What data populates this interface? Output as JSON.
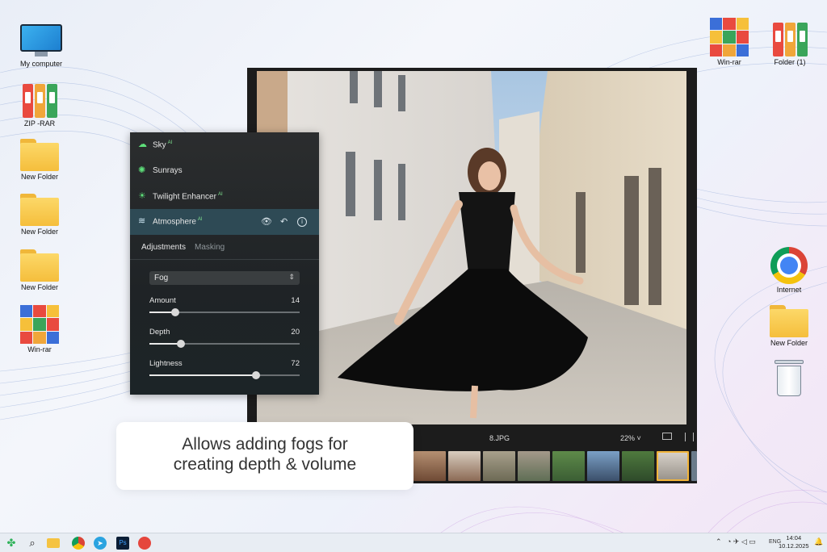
{
  "desktop": {
    "left_icons": [
      {
        "label": "My computer",
        "icon": "computer-icon"
      },
      {
        "label": "ZIP -RAR",
        "icon": "binder-icon"
      },
      {
        "label": "New Folder",
        "icon": "folder-icon"
      },
      {
        "label": "New Folder",
        "icon": "folder-icon"
      },
      {
        "label": "New Folder",
        "icon": "folder-icon"
      },
      {
        "label": "Win-rar",
        "icon": "winrar-icon"
      }
    ],
    "right_icons": [
      {
        "label": "Win-rar",
        "icon": "winrar-icon"
      },
      {
        "label": "Folder (1)",
        "icon": "binder-icon"
      },
      {
        "label": "Internet",
        "icon": "chrome-icon"
      },
      {
        "label": "New Folder",
        "icon": "folder-icon"
      },
      {
        "label": "",
        "icon": "recycle-bin-icon"
      }
    ]
  },
  "panel": {
    "items": [
      {
        "label": "Sky",
        "ai": "AI",
        "icon": "cloud-icon"
      },
      {
        "label": "Sunrays",
        "ai": "",
        "icon": "sun-icon"
      },
      {
        "label": "Twilight Enhancer",
        "ai": "AI",
        "icon": "twilight-icon"
      },
      {
        "label": "Atmosphere",
        "ai": "AI",
        "icon": "waves-icon"
      }
    ],
    "tabs": [
      "Adjustments",
      "Masking"
    ],
    "select_value": "Fog",
    "sliders": [
      {
        "label": "Amount",
        "value": "14",
        "fraction": 0.17
      },
      {
        "label": "Depth",
        "value": "20",
        "fraction": 0.21
      },
      {
        "label": "Lightness",
        "value": "72",
        "fraction": 0.71
      }
    ]
  },
  "viewer": {
    "file_name": "8.JPG",
    "zoom": "22% ˅",
    "thumbnail_count": 9
  },
  "callout": {
    "line1": "Allows adding fogs for",
    "line2": "creating depth & volume"
  },
  "taskbar": {
    "lang": "ENG",
    "time": "14:04",
    "date": "10.12.2025"
  },
  "colors": {
    "accent_green": "#5ee07a",
    "active_row": "#2e4a55"
  }
}
